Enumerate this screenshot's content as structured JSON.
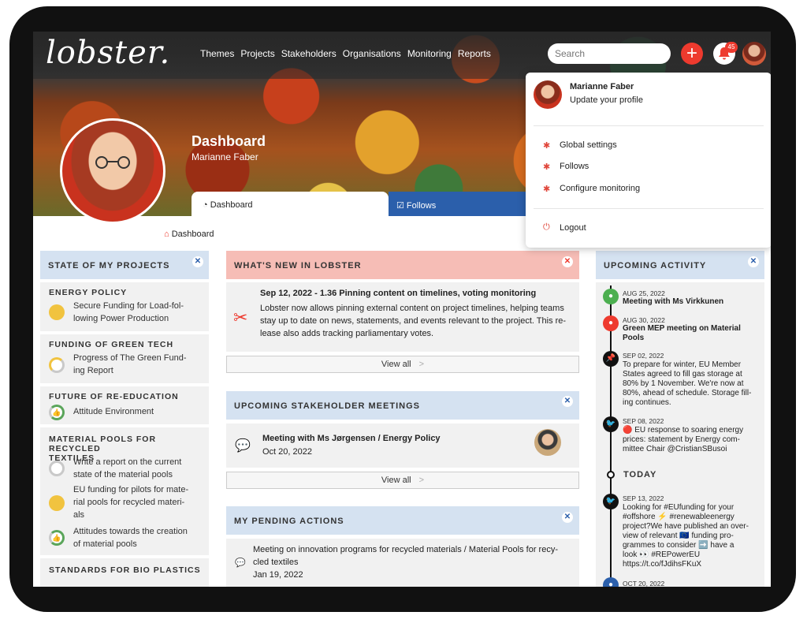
{
  "app": {
    "logo": "lobster."
  },
  "nav": {
    "items": [
      "Themes",
      "Projects",
      "Stakeholders",
      "Organisations",
      "Monitoring",
      "Reports"
    ]
  },
  "search": {
    "placeholder": "Search"
  },
  "notifications": {
    "count": "45"
  },
  "hero": {
    "title": "Dashboard",
    "subtitle": "Marianne Faber"
  },
  "tabs": [
    {
      "label": "Dashboard"
    },
    {
      "label": "Follows"
    }
  ],
  "breadcrumb": "Dashboard",
  "projects": {
    "title": "STATE OF MY PROJECTS",
    "groups": [
      {
        "title": "ENERGY POLICY",
        "items": [
          "Secure Funding for Load-fol-",
          "lowing Power Production"
        ]
      },
      {
        "title": "FUNDING OF GREEN TECH",
        "items": [
          "Progress of The Green Fund-",
          "ing Report"
        ]
      },
      {
        "title": "FUTURE OF RE-EDUCATION",
        "items": [
          "Attitude Environment"
        ]
      },
      {
        "title": "MATERIAL POOLS FOR RECYCLED",
        "title2": "TEXTILES",
        "items": [
          "Write a report on the current",
          "state of the material pools",
          "EU funding for pilots for mate-",
          "rial pools for recycled materi-",
          "als",
          "Attitudes towards the creation",
          "of material pools"
        ]
      },
      {
        "title": "STANDARDS FOR BIO PLASTICS"
      }
    ]
  },
  "news": {
    "title": "WHAT'S NEW IN LOBSTER",
    "headline": "Sep 12, 2022 - 1.36 Pinning content on timelines, voting monitoring",
    "body": [
      "Lobster now allows pinning external content on project timelines, helping teams",
      "stay up to date on news, statements, and events relevant to the project. This re-",
      "lease also adds tracking parliamentary votes."
    ],
    "view_all": "View all"
  },
  "meetings": {
    "title": "UPCOMING STAKEHOLDER MEETINGS",
    "name": "Meeting with Ms Jørgensen / Energy Policy",
    "date": "Oct 20, 2022",
    "view_all": "View all"
  },
  "pending": {
    "title": "MY PENDING ACTIONS",
    "text": [
      "Meeting on innovation programs for recycled materials / Material Pools for recy-",
      "cled textiles"
    ],
    "date": "Jan 19, 2022"
  },
  "activity": {
    "title": "UPCOMING ACTIVITY",
    "today": "TODAY",
    "items": [
      {
        "date": "AUG 25, 2022",
        "text": [
          "Meeting with Ms Virkkunen"
        ]
      },
      {
        "date": "AUG 30, 2022",
        "text": [
          "Green MEP meeting on Material",
          "Pools"
        ]
      },
      {
        "date": "SEP 02, 2022",
        "text": [
          "To prepare for winter, EU Member",
          "States agreed to fill gas storage at",
          "80% by 1 November. We're now at",
          "80%, ahead of schedule. Storage fill-",
          "ing continues."
        ]
      },
      {
        "date": "SEP 08, 2022",
        "text": [
          "🔴 EU response to soaring energy",
          "prices: statement by Energy com-",
          "mittee Chair @CristianSBusoi"
        ]
      },
      {
        "date": "SEP 13, 2022",
        "text": [
          "Looking for #EUfunding for your",
          "#offshore ⚡ #renewableenergy",
          "project?We have published an over-",
          "view of relevant 🇪🇺 funding pro-",
          "grammes to consider ➡️ have a",
          "look 👀 #REPowerEU",
          "https://t.co/fJdihsFKuX"
        ]
      },
      {
        "date": "OCT 20, 2022"
      }
    ]
  },
  "dropdown": {
    "name": "Marianne Faber",
    "subtitle": "Update your profile",
    "items": [
      "Global settings",
      "Follows",
      "Configure monitoring"
    ],
    "logout": "Logout"
  },
  "colors": {
    "accent": "#ee3a2e",
    "tab_blue": "#2b5fab",
    "panel_blue": "#d5e2f1",
    "panel_pink": "#f6bdb6"
  }
}
